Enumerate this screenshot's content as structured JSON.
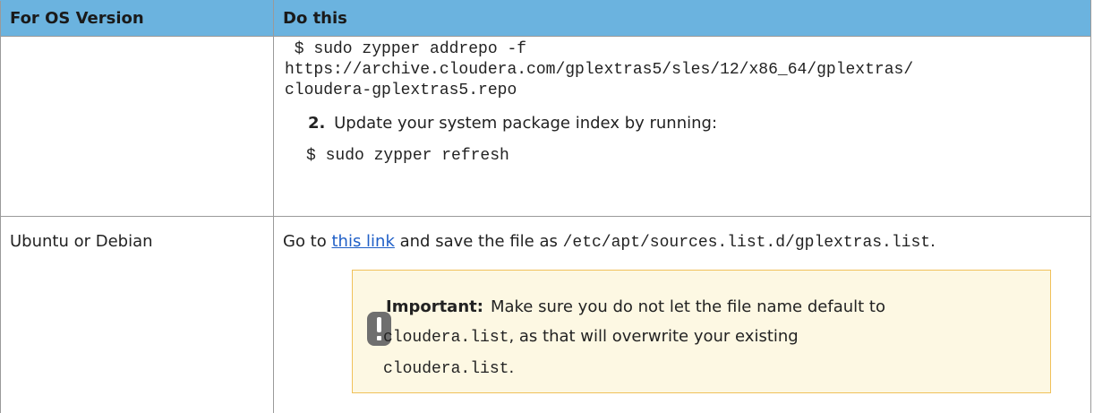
{
  "table": {
    "headers": [
      "For OS Version",
      "Do this"
    ],
    "row1": {
      "os": "",
      "command1": " $ sudo zypper addrepo -f\nhttps://archive.cloudera.com/gplextras5/sles/12/x86_64/gplextras/\ncloudera-gplextras5.repo",
      "step2_number": "2.",
      "step2_text": "Update your system package index by running:",
      "command2": "$ sudo zypper refresh"
    },
    "row2": {
      "os": "Ubuntu or Debian",
      "goto_prefix": "Go to ",
      "link_text": "this link",
      "goto_middle": " and save the file as ",
      "file_path": "/etc/apt/sources.list.d/gplextras.list",
      "goto_suffix": ".",
      "important": {
        "label": "Important:",
        "text_before": "Make sure you do not let the file name default to",
        "code1": "cloudera.list",
        "text_mid": ", as that will overwrite your existing",
        "code2": "cloudera.list",
        "text_end": "."
      }
    }
  },
  "icons": {
    "important": "exclamation-icon"
  },
  "colors": {
    "header_bg": "#6bb3df",
    "link": "#1f5fc7",
    "note_bg": "#fdf8e3",
    "note_border": "#f0c15a"
  }
}
